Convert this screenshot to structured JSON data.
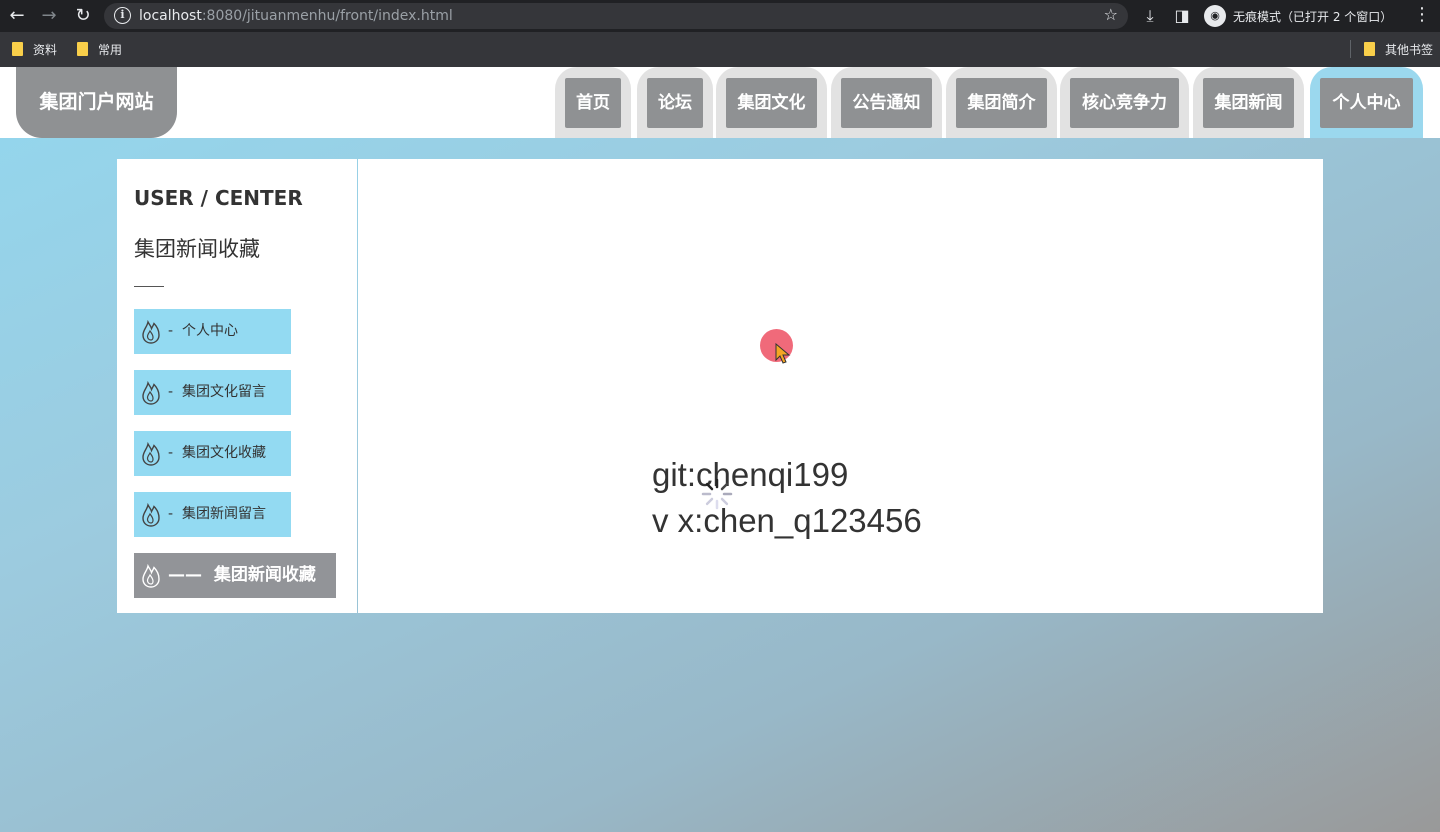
{
  "browser": {
    "url_host": "localhost",
    "url_rest": ":8080/jituanmenhu/front/index.html",
    "incognito_label": "无痕模式（已打开 2 个窗口）",
    "bookmarks": [
      "资料",
      "常用"
    ],
    "other_bookmarks": "其他书签"
  },
  "site": {
    "logo": "集团门户网站",
    "nav": [
      "首页",
      "论坛",
      "集团文化",
      "公告通知",
      "集团简介",
      "核心竞争力",
      "集团新闻",
      "个人中心"
    ],
    "active_nav": "个人中心"
  },
  "sidebar": {
    "title": "USER / CENTER",
    "subtitle": "集团新闻收藏",
    "items": [
      {
        "prefix": "-",
        "label": "个人中心"
      },
      {
        "prefix": "-",
        "label": "集团文化留言"
      },
      {
        "prefix": "-",
        "label": "集团文化收藏"
      },
      {
        "prefix": "-",
        "label": "集团新闻留言"
      },
      {
        "prefix": "——",
        "label": "集团新闻收藏"
      }
    ]
  },
  "content": {
    "watermark_line1": "git:chenqi199",
    "watermark_line2": "v x:chen_q123456"
  },
  "colors": {
    "nav_active": "#9bd8ee",
    "nav_inactive": "#8f9193",
    "sidebar_item": "#93daf2",
    "sidebar_item_active": "#929498"
  }
}
